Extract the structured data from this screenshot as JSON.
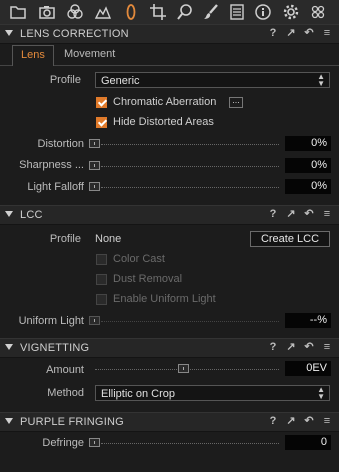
{
  "toolbar": {
    "icons": [
      "folder-icon",
      "camera-icon",
      "color-circles-icon",
      "exposure-icon",
      "lens-icon",
      "crop-icon",
      "search-icon",
      "brush-icon",
      "metadata-icon",
      "info-icon",
      "gear-icon",
      "batch-icon"
    ],
    "active": "lens-icon",
    "accent": "#e38a3c"
  },
  "lens_correction": {
    "title": "LENS CORRECTION",
    "tabs": [
      "Lens",
      "Movement"
    ],
    "active_tab": "Lens",
    "profile_label": "Profile",
    "profile_value": "Generic",
    "chromatic_aberration": {
      "label": "Chromatic Aberration",
      "checked": true
    },
    "hide_distorted": {
      "label": "Hide Distorted Areas",
      "checked": true
    },
    "distortion": {
      "label": "Distortion",
      "value": "0%"
    },
    "sharpness": {
      "label": "Sharpness ...",
      "value": "0%"
    },
    "light_falloff": {
      "label": "Light Falloff",
      "value": "0%"
    }
  },
  "lcc": {
    "title": "LCC",
    "profile_label": "Profile",
    "profile_value": "None",
    "create_button": "Create LCC",
    "color_cast": {
      "label": "Color Cast",
      "checked": false,
      "enabled": false
    },
    "dust_removal": {
      "label": "Dust Removal",
      "checked": false,
      "enabled": false
    },
    "uniform_light_cb": {
      "label": "Enable Uniform Light",
      "checked": false,
      "enabled": false
    },
    "uniform_light": {
      "label": "Uniform Light",
      "value": "--%"
    }
  },
  "vignetting": {
    "title": "VIGNETTING",
    "amount_label": "Amount",
    "amount_value": "0EV",
    "method_label": "Method",
    "method_value": "Elliptic on Crop"
  },
  "purple_fringing": {
    "title": "PURPLE FRINGING",
    "defringe_label": "Defringe",
    "defringe_value": "0"
  },
  "header_icons": {
    "help": "?",
    "expand": "↗",
    "reset": "↶",
    "menu": "≡"
  }
}
